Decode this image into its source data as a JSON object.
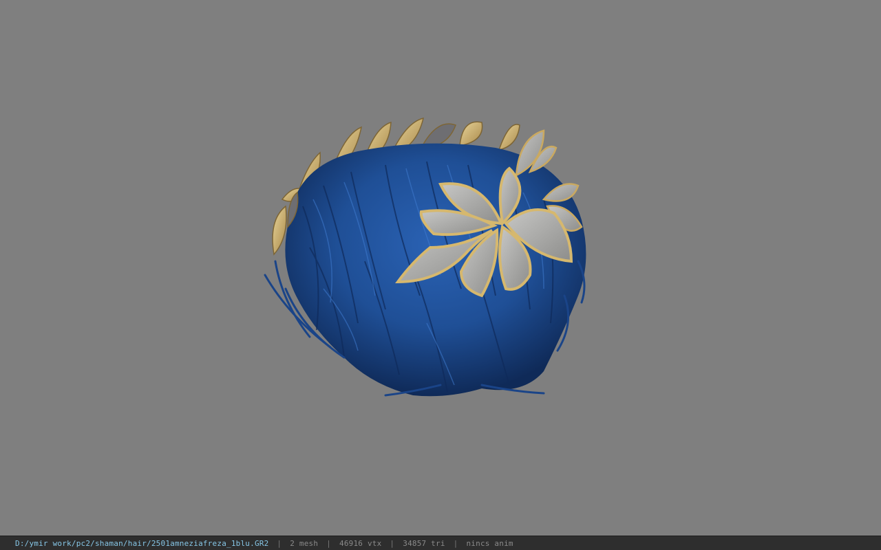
{
  "viewport": {
    "background_color": "#7f7f7f",
    "model_label": "hair-model-with-leaf-crown",
    "hair_color": "#1f4f96",
    "leaf_color": "#d1b576"
  },
  "statusbar": {
    "file_path": "D:/ymir work/pc2/shaman/hair/2501amneziafreza_1blu.GR2",
    "separator": "|",
    "mesh": "2 mesh",
    "vtx": "46916 vtx",
    "tri": "34857 tri",
    "anim": "nincs anim"
  }
}
